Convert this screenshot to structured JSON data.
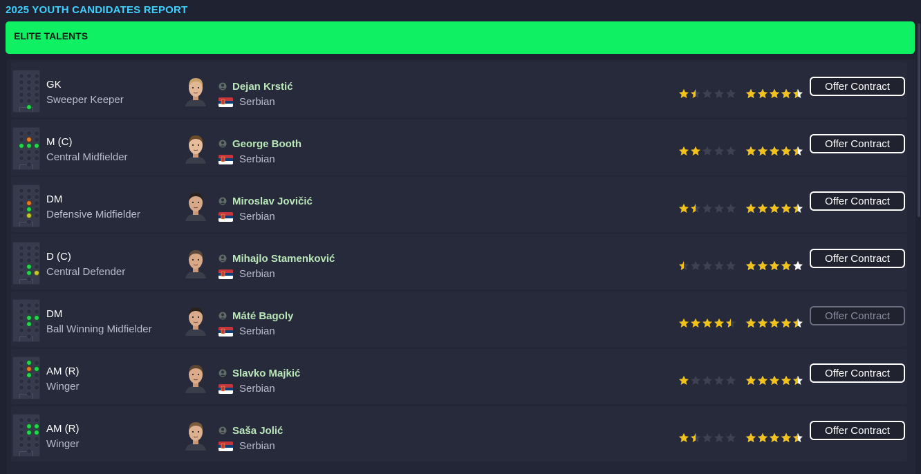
{
  "page": {
    "title": "2025 YOUTH CANDIDATES REPORT"
  },
  "section": {
    "title": "ELITE TALENTS"
  },
  "colors": {
    "accent_green": "#0ff063",
    "title_cyan": "#3fd0ff",
    "name_green": "#b9e7b8",
    "star_gold": "#f2c21b",
    "star_empty": "#3d4152",
    "star_pa_white": "#ffffff"
  },
  "players": [
    {
      "pos": "GK",
      "role": "Sweeper Keeper",
      "name": "Dejan Krstić",
      "nation": "Serbian",
      "current_ability_stars": 1.5,
      "potential_ability_stars": 4.5,
      "action": "Offer Contract",
      "action_enabled": true,
      "pitch": [
        {
          "c": 2,
          "r": 5,
          "t": "green"
        }
      ],
      "hair": "#c9a46a",
      "skin": "#e2b796"
    },
    {
      "pos": "M (C)",
      "role": "Central Midfielder",
      "name": "George Booth",
      "nation": "Serbian",
      "current_ability_stars": 2,
      "potential_ability_stars": 4.5,
      "action": "Offer Contract",
      "action_enabled": true,
      "pitch": [
        {
          "c": 2,
          "r": 1,
          "t": "orange"
        },
        {
          "c": 2,
          "r": 2,
          "t": "green"
        },
        {
          "c": 1,
          "r": 2,
          "t": "green"
        },
        {
          "c": 3,
          "r": 2,
          "t": "green"
        }
      ],
      "hair": "#6b4a2a",
      "skin": "#e6bd9b"
    },
    {
      "pos": "DM",
      "role": "Defensive Midfielder",
      "name": "Miroslav Jovičić",
      "nation": "Serbian",
      "current_ability_stars": 1.5,
      "potential_ability_stars": 4.5,
      "action": "Offer Contract",
      "action_enabled": true,
      "pitch": [
        {
          "c": 2,
          "r": 2,
          "t": "orange"
        },
        {
          "c": 2,
          "r": 3,
          "t": "green"
        },
        {
          "c": 2,
          "r": 4,
          "t": "yellow"
        }
      ],
      "hair": "#2a211c",
      "skin": "#d7a98a"
    },
    {
      "pos": "D (C)",
      "role": "Central Defender",
      "name": "Mihajlo Stamenković",
      "nation": "Serbian",
      "current_ability_stars": 0.5,
      "potential_ability_stars": 4,
      "action": "Offer Contract",
      "action_enabled": true,
      "pitch": [
        {
          "c": 2,
          "r": 3,
          "t": "green"
        },
        {
          "c": 2,
          "r": 4,
          "t": "green"
        },
        {
          "c": 3,
          "r": 4,
          "t": "yellow"
        }
      ],
      "hair": "#5e4a3a",
      "skin": "#d9a987"
    },
    {
      "pos": "DM",
      "role": "Ball Winning Midfielder",
      "name": "Máté Bagoly",
      "nation": "Serbian",
      "current_ability_stars": 4.5,
      "potential_ability_stars": 4.5,
      "action": "Offer Contract",
      "action_enabled": false,
      "pitch": [
        {
          "c": 2,
          "r": 2,
          "t": "green"
        },
        {
          "c": 3,
          "r": 2,
          "t": "green"
        },
        {
          "c": 2,
          "r": 3,
          "t": "green"
        }
      ],
      "hair": "#2a211c",
      "skin": "#d9aa8c"
    },
    {
      "pos": "AM (R)",
      "role": "Winger",
      "name": "Slavko Majkić",
      "nation": "Serbian",
      "current_ability_stars": 1,
      "potential_ability_stars": 4.5,
      "action": "Offer Contract",
      "action_enabled": true,
      "pitch": [
        {
          "c": 2,
          "r": 0,
          "t": "green"
        },
        {
          "c": 2,
          "r": 1,
          "t": "orange"
        },
        {
          "c": 3,
          "r": 1,
          "t": "green"
        },
        {
          "c": 2,
          "r": 2,
          "t": "green"
        }
      ],
      "hair": "#5b4330",
      "skin": "#dcab89"
    },
    {
      "pos": "AM (R)",
      "role": "Winger",
      "name": "Saša Jolić",
      "nation": "Serbian",
      "current_ability_stars": 1.5,
      "potential_ability_stars": 4.5,
      "action": "Offer Contract",
      "action_enabled": true,
      "pitch": [
        {
          "c": 2,
          "r": 1,
          "t": "green"
        },
        {
          "c": 3,
          "r": 1,
          "t": "green"
        },
        {
          "c": 2,
          "r": 2,
          "t": "green"
        },
        {
          "c": 3,
          "r": 2,
          "t": "green"
        }
      ],
      "hair": "#7a5b3e",
      "skin": "#ddb08f"
    }
  ]
}
